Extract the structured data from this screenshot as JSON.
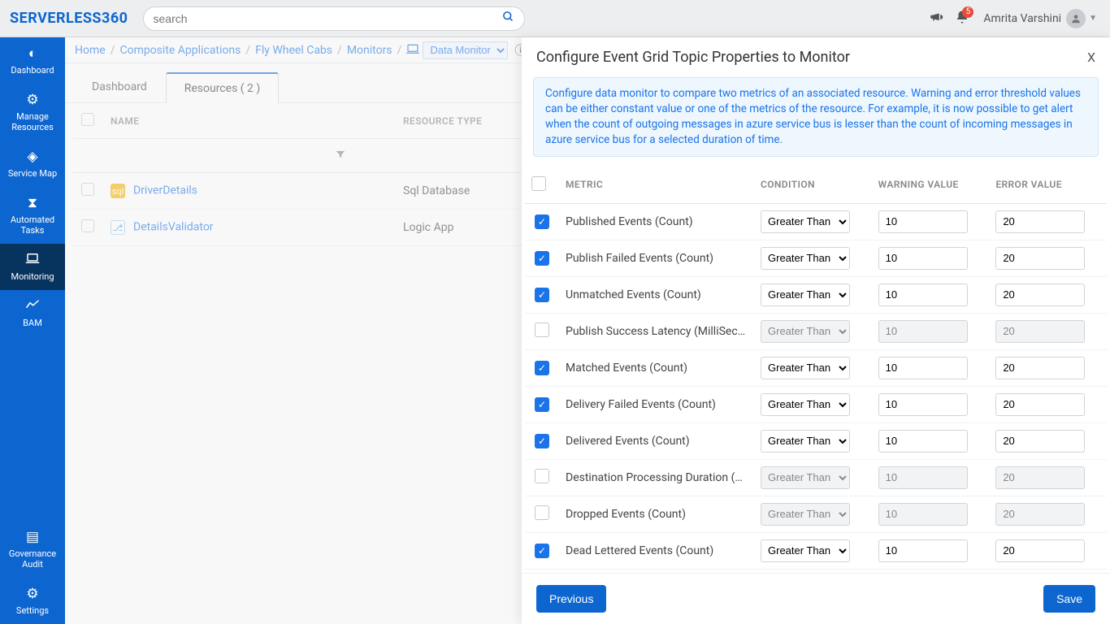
{
  "brand": "SERVERLESS360",
  "search": {
    "placeholder": "search"
  },
  "notifications": {
    "count": "5"
  },
  "user": {
    "name": "Amrita Varshini"
  },
  "sidebar": {
    "items": [
      {
        "label": "Dashboard"
      },
      {
        "label": "Manage Resources"
      },
      {
        "label": "Service Map"
      },
      {
        "label": "Automated Tasks"
      },
      {
        "label": "Monitoring"
      },
      {
        "label": "BAM"
      }
    ],
    "bottom": [
      {
        "label": "Governance Audit"
      },
      {
        "label": "Settings"
      }
    ]
  },
  "breadcrumbs": {
    "home": "Home",
    "ca": "Composite Applications",
    "app": "Fly Wheel Cabs",
    "mon": "Monitors",
    "selected": "Data Monitor"
  },
  "tabs": {
    "dashboard": "Dashboard",
    "resources": "Resources ( 2 )"
  },
  "table": {
    "columns": {
      "name": "NAME",
      "type": "RESOURCE TYPE"
    },
    "rows": [
      {
        "name": "DriverDetails",
        "type": "Sql Database",
        "icon": "sql"
      },
      {
        "name": "DetailsValidator",
        "type": "Logic App",
        "icon": "la"
      }
    ]
  },
  "panel": {
    "title": "Configure Event Grid Topic Properties to Monitor",
    "close": "X",
    "desc": "Configure data monitor to compare two metrics of an associated resource. Warning and error threshold values can be either constant value or one of the metrics of the resource. For example, it is now possible to get alert when the count of outgoing messages in azure service bus is lesser than the count of incoming messages in azure service bus for a selected duration of time.",
    "columns": {
      "metric": "METRIC",
      "condition": "CONDITION",
      "warning": "WARNING VALUE",
      "error": "ERROR VALUE"
    },
    "condition_option": "Greater Than",
    "metrics": [
      {
        "checked": true,
        "name": "Published Events (Count)",
        "warn": "10",
        "err": "20"
      },
      {
        "checked": true,
        "name": "Publish Failed Events (Count)",
        "warn": "10",
        "err": "20"
      },
      {
        "checked": true,
        "name": "Unmatched Events (Count)",
        "warn": "10",
        "err": "20"
      },
      {
        "checked": false,
        "name": "Publish Success Latency (MilliSeconds)",
        "warn": "10",
        "err": "20"
      },
      {
        "checked": true,
        "name": "Matched Events (Count)",
        "warn": "10",
        "err": "20"
      },
      {
        "checked": true,
        "name": "Delivery Failed Events (Count)",
        "warn": "10",
        "err": "20"
      },
      {
        "checked": true,
        "name": "Delivered Events (Count)",
        "warn": "10",
        "err": "20"
      },
      {
        "checked": false,
        "name": "Destination Processing Duration (MilliSeconds)",
        "warn": "10",
        "err": "20"
      },
      {
        "checked": false,
        "name": "Dropped Events (Count)",
        "warn": "10",
        "err": "20"
      },
      {
        "checked": true,
        "name": "Dead Lettered Events (Count)",
        "warn": "10",
        "err": "20"
      }
    ],
    "buttons": {
      "prev": "Previous",
      "save": "Save"
    }
  }
}
